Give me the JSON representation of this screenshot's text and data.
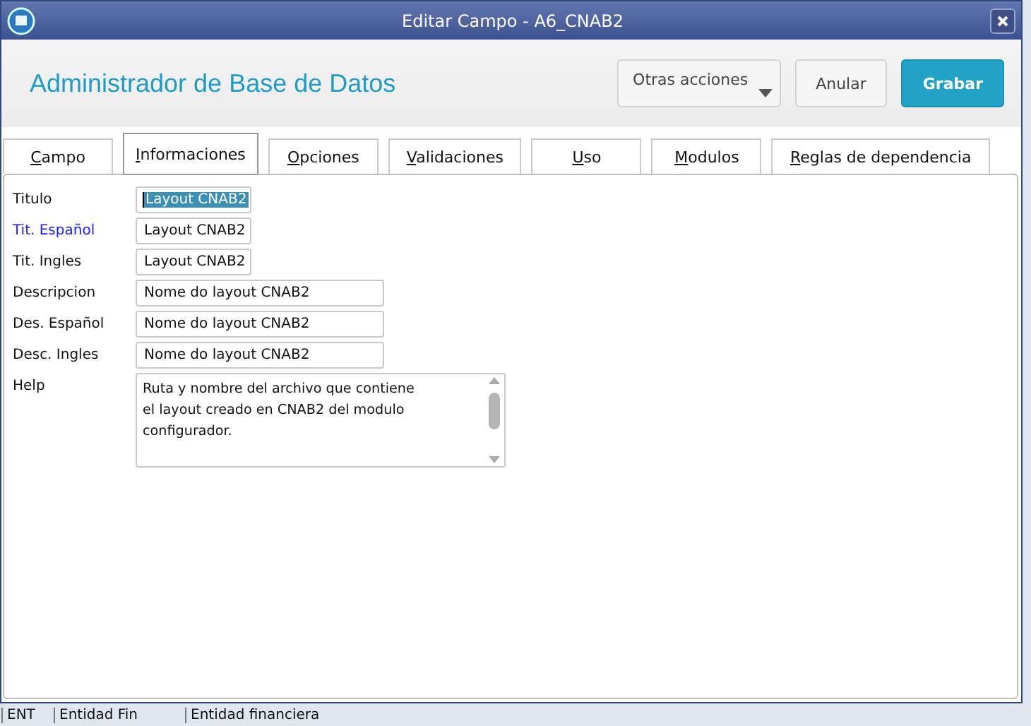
{
  "window": {
    "title": "Editar Campo - A6_CNAB2"
  },
  "header": {
    "title": "Administrador de Base de Datos",
    "buttons": [
      {
        "label": "Otras acciones",
        "kind": "menu"
      },
      {
        "label": "Anular",
        "kind": "plain"
      },
      {
        "label": "Grabar",
        "kind": "primary"
      }
    ]
  },
  "tabs": [
    {
      "label": "Campo",
      "selected": false
    },
    {
      "label": "Informaciones",
      "selected": true
    },
    {
      "label": "Opciones",
      "selected": false
    },
    {
      "label": "Validaciones",
      "selected": false
    },
    {
      "label": "Uso",
      "selected": false
    },
    {
      "label": "Modulos",
      "selected": false
    },
    {
      "label": "Reglas de dependencia",
      "selected": false
    }
  ],
  "fields": [
    {
      "label": "Titulo",
      "value": "Layout CNAB2",
      "kind": "short",
      "emphasized": false,
      "selected": true
    },
    {
      "label": "Tit. Español",
      "value": "Layout CNAB2",
      "kind": "short",
      "emphasized": true,
      "selected": false
    },
    {
      "label": "Tit. Ingles",
      "value": "Layout CNAB2",
      "kind": "short",
      "emphasized": false,
      "selected": false
    },
    {
      "label": "Descripcion",
      "value": "Nome do layout CNAB2",
      "kind": "long",
      "emphasized": false,
      "selected": false
    },
    {
      "label": "Des. Español",
      "value": "Nome do layout CNAB2",
      "kind": "long",
      "emphasized": false,
      "selected": false
    },
    {
      "label": "Desc. Ingles",
      "value": "Nome do layout CNAB2",
      "kind": "long",
      "emphasized": false,
      "selected": false
    }
  ],
  "help": {
    "label": "Help",
    "lines": [
      "Ruta y nombre del archivo que contiene",
      "el layout creado en CNAB2 del modulo",
      "configurador."
    ]
  },
  "background_row": [
    "ENT",
    "Entidad Fin",
    "Entidad financiera"
  ]
}
